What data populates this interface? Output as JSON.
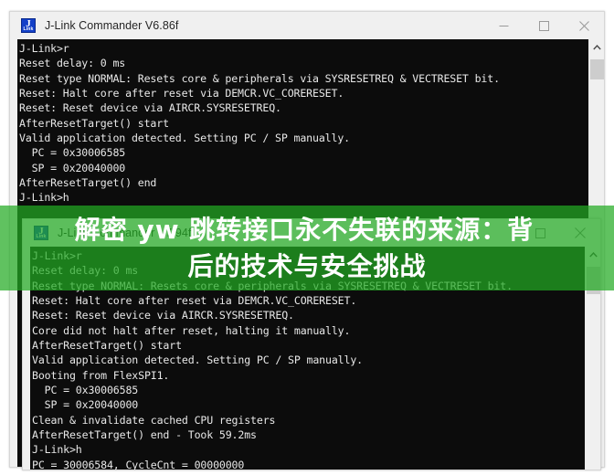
{
  "back_window": {
    "title": "J-Link Commander V6.86f",
    "icon": "jlink-icon",
    "icon_letter": "J",
    "icon_sub": "Link",
    "controls": {
      "minimize": "minimize-icon",
      "maximize": "maximize-icon",
      "close": "close-icon"
    },
    "console_text": "J-Link>r\nReset delay: 0 ms\nReset type NORMAL: Resets core & peripherals via SYSRESETREQ & VECTRESET bit.\nReset: Halt core after reset via DEMCR.VC_CORERESET.\nReset: Reset device via AIRCR.SYSRESETREQ.\nAfterResetTarget() start\nValid application detected. Setting PC / SP manually.\n  PC = 0x30006585\n  SP = 0x20040000\nAfterResetTarget() end\nJ-Link>h\n",
    "scrollbar": {
      "up_arrow": "chevron-up-icon",
      "thumb": "scrollbar-thumb"
    }
  },
  "front_window": {
    "title": "J-Link Commander V7.94f",
    "icon": "jlink-icon",
    "icon_letter": "J",
    "icon_sub": "Link",
    "controls": {
      "maximize": "maximize-icon",
      "close": "close-icon"
    },
    "console_text": "J-Link>r\nReset delay: 0 ms\nReset type NORMAL: Resets core & peripherals via SYSRESETREQ & VECTRESET bit.\nReset: Halt core after reset via DEMCR.VC_CORERESET.\nReset: Reset device via AIRCR.SYSRESETREQ.\nCore did not halt after reset, halting it manually.\nAfterResetTarget() start\nValid application detected. Setting PC / SP manually.\nBooting from FlexSPI1.\n  PC = 0x30006585\n  SP = 0x20040000\nClean & invalidate cached CPU registers\nAfterResetTarget() end - Took 59.2ms\nJ-Link>h\nPC = 30006584, CycleCnt = 00000000\n",
    "scrollbar": {
      "up_arrow": "chevron-up-icon",
      "thumb": "scrollbar-thumb"
    }
  },
  "promo_banner": {
    "line1": "解密 yw 跳转接口永不失联的来源：背",
    "line2": "后的技术与安全挑战",
    "background_color": "#22aa22",
    "text_color": "#ffffff"
  }
}
